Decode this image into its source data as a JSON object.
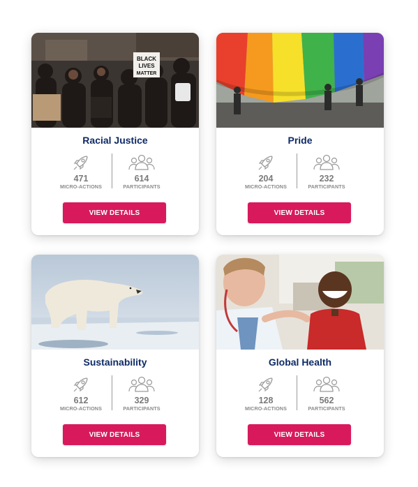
{
  "cards": [
    {
      "title": "Racial Justice",
      "photo": "protest-photo",
      "sign_text": "BLACK LIVES MATTER",
      "stats": [
        {
          "value": "471",
          "label": "MICRO-ACTIONS",
          "icon": "rocket-icon"
        },
        {
          "value": "614",
          "label": "PARTICIPANTS",
          "icon": "people-icon"
        }
      ],
      "button": "VIEW DETAILS"
    },
    {
      "title": "Pride",
      "photo": "rainbow-flag-photo",
      "stats": [
        {
          "value": "204",
          "label": "MICRO-ACTIONS",
          "icon": "rocket-icon"
        },
        {
          "value": "232",
          "label": "PARTICIPANTS",
          "icon": "people-icon"
        }
      ],
      "button": "VIEW DETAILS"
    },
    {
      "title": "Sustainability",
      "photo": "polar-bear-photo",
      "stats": [
        {
          "value": "612",
          "label": "MICRO-ACTIONS",
          "icon": "rocket-icon"
        },
        {
          "value": "329",
          "label": "PARTICIPANTS",
          "icon": "people-icon"
        }
      ],
      "button": "VIEW DETAILS"
    },
    {
      "title": "Global Health",
      "photo": "doctor-child-photo",
      "stats": [
        {
          "value": "128",
          "label": "MICRO-ACTIONS",
          "icon": "rocket-icon"
        },
        {
          "value": "562",
          "label": "PARTICIPANTS",
          "icon": "people-icon"
        }
      ],
      "button": "VIEW DETAILS"
    }
  ],
  "colors": {
    "title": "#0e2a66",
    "button": "#d81a5c",
    "stat_text": "#7a7a7a",
    "icon_stroke": "#9a9a9a"
  }
}
